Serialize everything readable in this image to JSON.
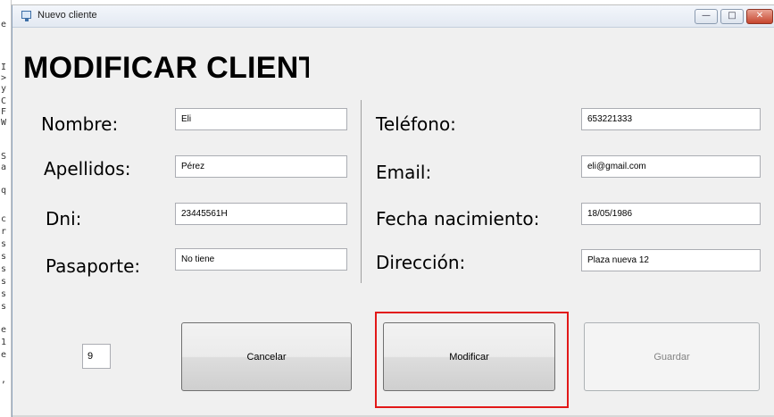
{
  "background_window": {
    "text_fragments": [
      "e",
      "I",
      ">",
      "y",
      "C",
      "F",
      "W",
      "S",
      "a",
      "q",
      "c",
      "r",
      "s",
      "s",
      "s",
      "s",
      "s",
      "s",
      "e",
      "1",
      "e",
      ","
    ]
  },
  "window": {
    "title": "Nuevo cliente",
    "controls": {
      "minimize": "—",
      "maximize": "□",
      "close": "✕"
    }
  },
  "form": {
    "heading": "MODIFICAR CLIENTE",
    "left_fields": [
      {
        "label": "Nombre:",
        "value": "Eli"
      },
      {
        "label": "Apellidos:",
        "value": "Pérez"
      },
      {
        "label": "Dni:",
        "value": "23445561H"
      },
      {
        "label": "Pasaporte:",
        "value": "No tiene"
      }
    ],
    "right_fields": [
      {
        "label": "Teléfono:",
        "value": "653221333"
      },
      {
        "label": "Email:",
        "value": "eli@gmail.com"
      },
      {
        "label": "Fecha nacimiento:",
        "value": "18/05/1986"
      },
      {
        "label": "Dirección:",
        "value": "Plaza nueva 12"
      }
    ],
    "id_value": "9"
  },
  "buttons": {
    "cancel": "Cancelar",
    "modify": "Modificar",
    "save": "Guardar"
  },
  "colors": {
    "highlight": "#e21818",
    "window_bg": "#f0f0f0"
  }
}
